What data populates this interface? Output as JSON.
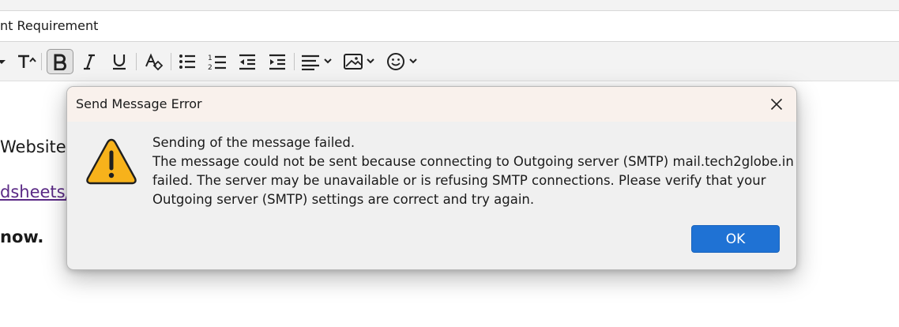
{
  "composer": {
    "subject": "nt Requirement",
    "body_lines": [
      "Website ,",
      "dsheets/",
      "now."
    ]
  },
  "toolbar": {
    "icons": [
      "dropdown-arrow-icon",
      "font-size-icon",
      "bold-icon",
      "italic-icon",
      "underline-icon",
      "clear-formatting-icon",
      "bulleted-list-icon",
      "numbered-list-icon",
      "outdent-icon",
      "indent-icon",
      "align-icon",
      "insert-image-icon",
      "emoji-icon"
    ],
    "bold_active": true
  },
  "dialog": {
    "title": "Send Message Error",
    "message_lines": [
      "Sending of the message failed.",
      "The message could not be sent because connecting to Outgoing server (SMTP) mail.tech2globe.in",
      "failed. The server may be unavailable or is refusing SMTP connections. Please verify that your",
      "Outgoing server (SMTP) settings are correct and try again."
    ],
    "ok_label": "OK",
    "icon": "warning-icon"
  },
  "colors": {
    "accent": "#1f72d4",
    "warning": "#f7b21b",
    "titlebar": "#f9f1ec",
    "link": "#5b2a86"
  }
}
